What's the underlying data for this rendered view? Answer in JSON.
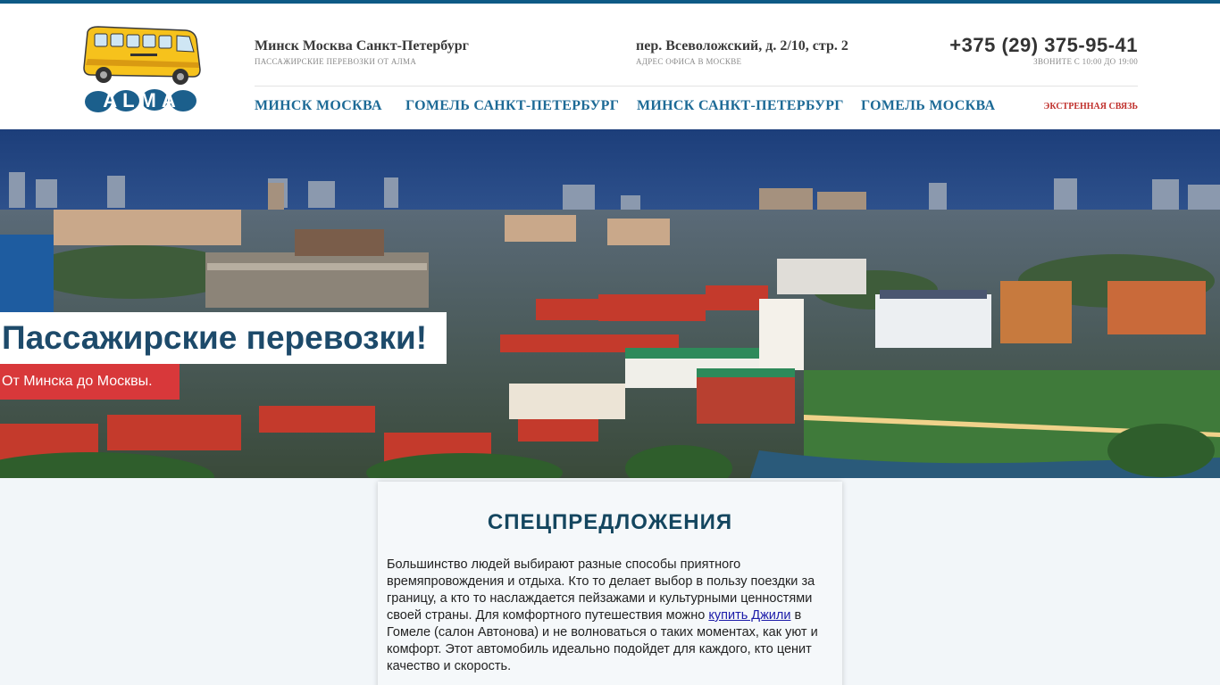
{
  "header": {
    "logo_text": "ALMA",
    "routes_title": "Минск Москва Санкт-Петербург",
    "routes_sub": "ПАССАЖИРСКИЕ ПЕРЕВОЗКИ ОТ АЛМА",
    "address": "пер. Всеволожский, д. 2/10, стр. 2",
    "address_sub": "АДРЕС ОФИСА В МОСКВЕ",
    "phone": "+375 (29) 375-95-41",
    "phone_sub": "ЗВОНИТЕ С 10:00 ДО 19:00"
  },
  "nav": {
    "items": [
      {
        "label": "МИНСК МОСКВА"
      },
      {
        "label": "ГОМЕЛЬ САНКТ-ПЕТЕРБУРГ"
      },
      {
        "label": "МИНСК САНКТ-ПЕТЕРБУРГ"
      },
      {
        "label": "ГОМЕЛЬ МОСКВА"
      }
    ],
    "emergency": "ЭКСТРЕННАЯ СВЯЗЬ"
  },
  "hero": {
    "title": "Пассажирские перевозки!",
    "subtitle": "От Минска до Москвы."
  },
  "content": {
    "title": "СПЕЦПРЕДЛОЖЕНИЯ",
    "text_before": "Большинство людей выбирают разные способы приятного времяпровождения и отдыха. Кто то делает выбор в пользу поездки за границу, а кто то наслаждается пейзажами и культурными ценностями своей страны. Для комфортного путешествия можно ",
    "link": "купить Джили",
    "text_after": " в Гомеле (салон Автонова) и не волноваться о таких моментах, как уют и комфорт. Этот автомобиль идеально подойдет для каждого, кто ценит качество и скорость."
  },
  "colors": {
    "brand_blue": "#1d6a96",
    "accent_red": "#d8383a",
    "title_dark": "#14465f"
  }
}
